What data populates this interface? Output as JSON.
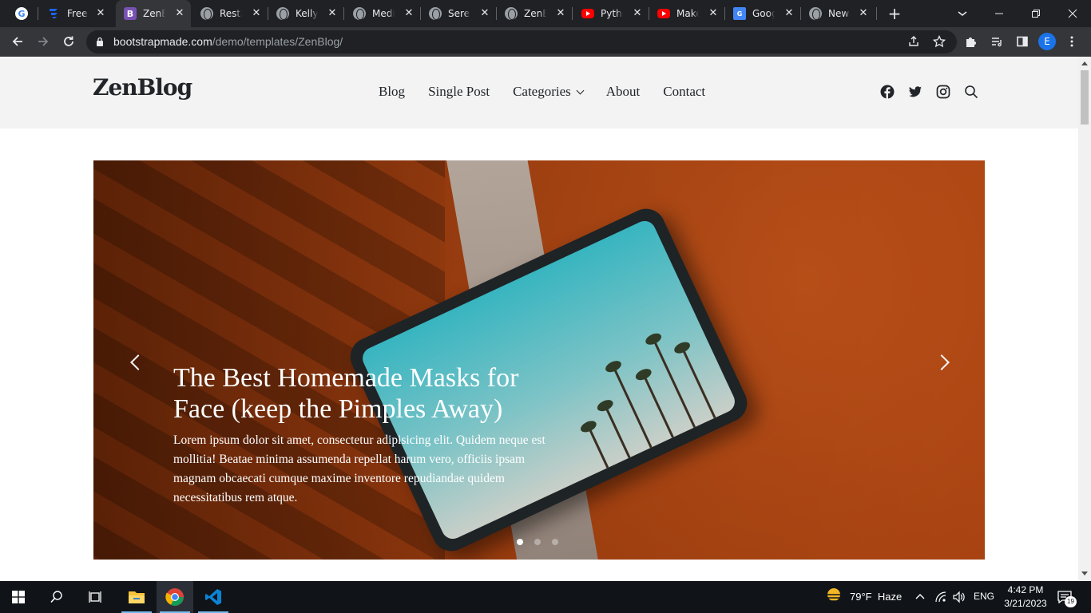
{
  "browser": {
    "tabs": [
      {
        "title": "",
        "icon": "google-icon"
      },
      {
        "title": "Free B",
        "icon": "flowbite-icon"
      },
      {
        "title": "ZenBl",
        "icon": "bootstrap-icon"
      },
      {
        "title": "Restau",
        "icon": "globe-icon"
      },
      {
        "title": "Kelly E",
        "icon": "globe-icon"
      },
      {
        "title": "Medic",
        "icon": "globe-icon"
      },
      {
        "title": "Seren",
        "icon": "globe-icon"
      },
      {
        "title": "ZenBl",
        "icon": "globe-icon"
      },
      {
        "title": "Pytho",
        "icon": "youtube-icon"
      },
      {
        "title": "Make",
        "icon": "youtube-icon"
      },
      {
        "title": "Googl",
        "icon": "google-sheets-icon"
      },
      {
        "title": "New T",
        "icon": "globe-icon"
      }
    ],
    "active_tab": 2,
    "url_host": "bootstrapmade.com",
    "url_path": "/demo/templates/ZenBlog/",
    "profile_initial": "E",
    "new_tab_label": "+",
    "close_glyph": "✕"
  },
  "site": {
    "logo": "ZenBlog",
    "nav": {
      "blog": "Blog",
      "single_post": "Single Post",
      "categories": "Categories",
      "about": "About",
      "contact": "Contact"
    },
    "social_icons": [
      "facebook-icon",
      "twitter-icon",
      "instagram-icon",
      "search-icon"
    ]
  },
  "hero": {
    "title": "The Best Homemade Masks for Face (keep the Pimples Away)",
    "description": "Lorem ipsum dolor sit amet, consectetur adipisicing elit. Quidem neque est mollitia! Beatae minima assumenda repellat harum vero, officiis ipsam magnam obcaecati cumque maxime inventore repudiandae quidem necessitatibus rem atque.",
    "slide_count": 3,
    "active_slide": 0
  },
  "taskbar": {
    "weather_temp": "79°F",
    "weather_desc": "Haze",
    "language": "ENG",
    "time": "4:42 PM",
    "date": "3/21/2023",
    "notification_count": "19"
  },
  "colors": {
    "chrome_dark": "#202124",
    "chrome_toolbar": "#35363a",
    "header_bg": "#f3f3f3",
    "text_dark": "#212529",
    "profile_blue": "#1a73e8"
  }
}
